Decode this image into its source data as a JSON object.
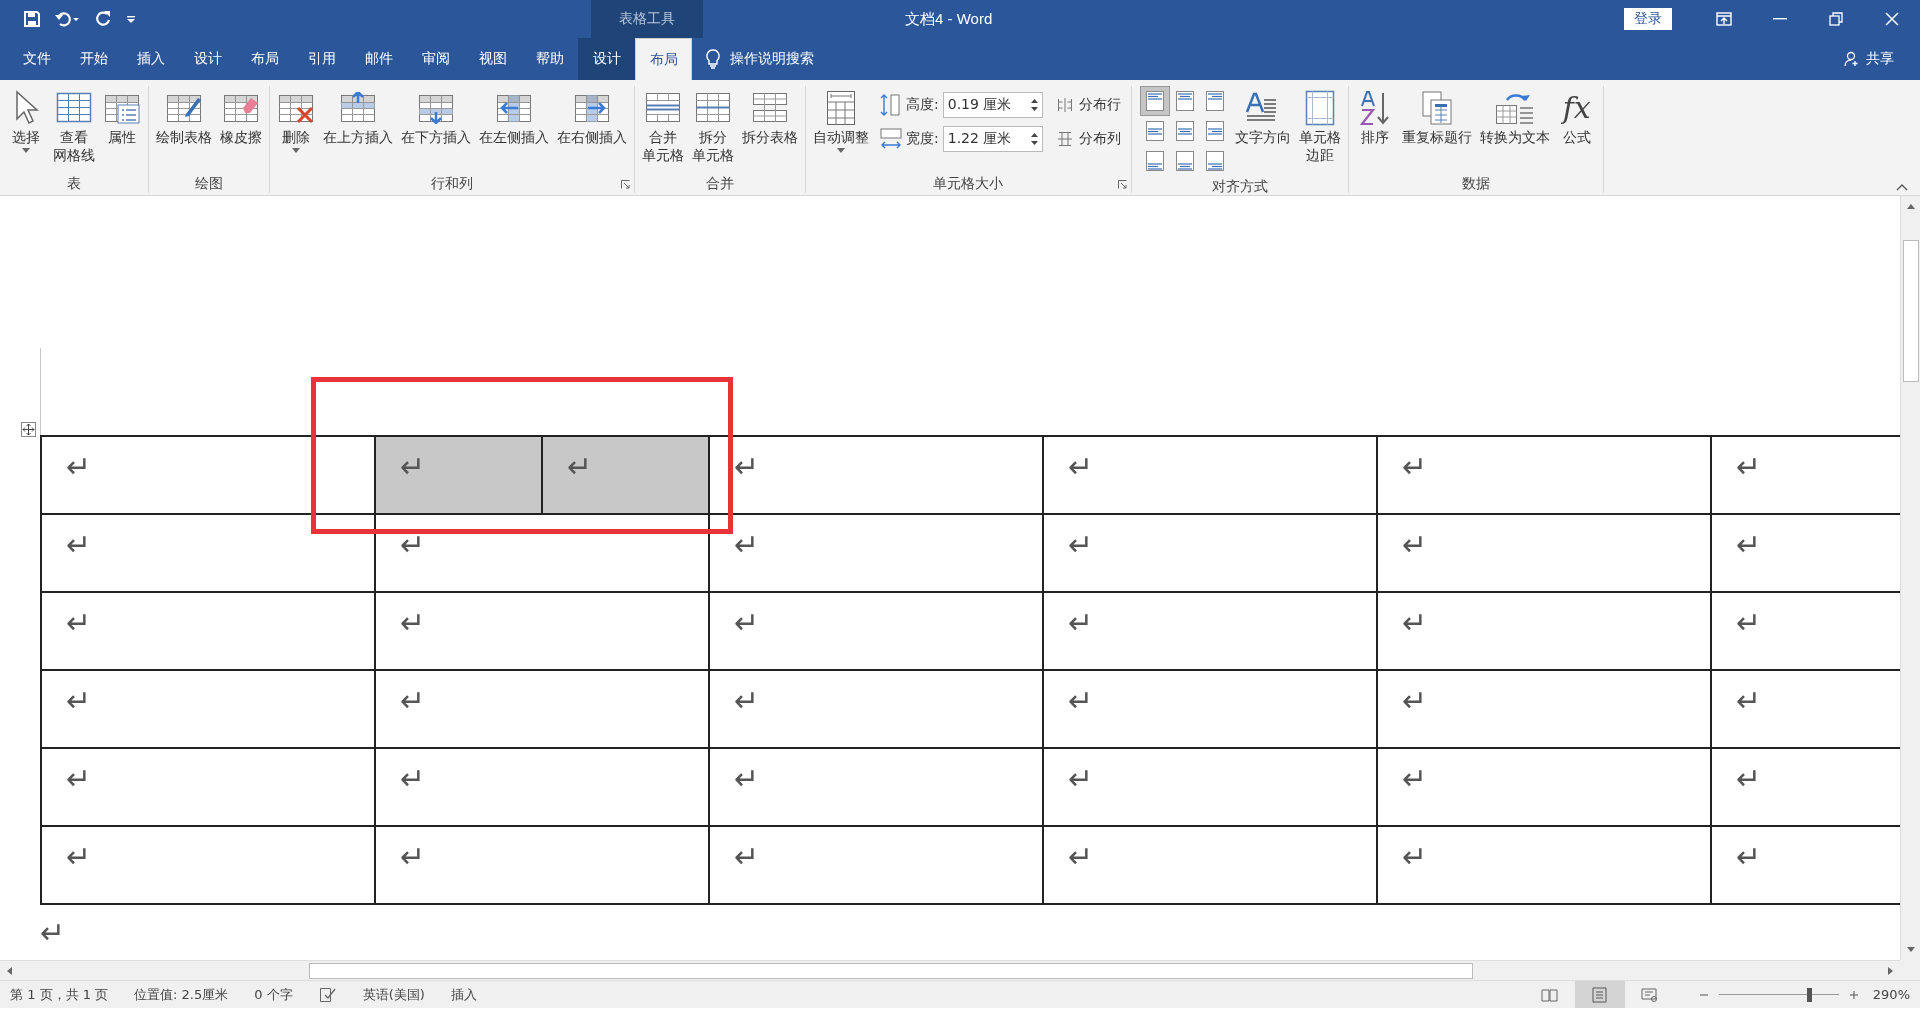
{
  "title_bar": {
    "context_group": "表格工具",
    "title": "文档4 - Word",
    "sign_in": "登录"
  },
  "menu_tabs": [
    {
      "label": "文件",
      "selected": false,
      "kind": "file"
    },
    {
      "label": "开始",
      "selected": false,
      "kind": "normal"
    },
    {
      "label": "插入",
      "selected": false,
      "kind": "normal"
    },
    {
      "label": "设计",
      "selected": false,
      "kind": "normal"
    },
    {
      "label": "布局",
      "selected": false,
      "kind": "normal"
    },
    {
      "label": "引用",
      "selected": false,
      "kind": "normal"
    },
    {
      "label": "邮件",
      "selected": false,
      "kind": "normal"
    },
    {
      "label": "审阅",
      "selected": false,
      "kind": "normal"
    },
    {
      "label": "视图",
      "selected": false,
      "kind": "normal"
    },
    {
      "label": "帮助",
      "selected": false,
      "kind": "normal"
    },
    {
      "label": "设计",
      "selected": false,
      "kind": "context"
    },
    {
      "label": "布局",
      "selected": true,
      "kind": "context"
    }
  ],
  "tell_me": {
    "placeholder": "操作说明搜索"
  },
  "share": "共享",
  "ribbon": [
    {
      "label": "表",
      "items": [
        {
          "kind": "large",
          "label": [
            "选择"
          ],
          "dropdown": true
        },
        {
          "kind": "large",
          "label": [
            "查看",
            "网格线"
          ]
        },
        {
          "kind": "large",
          "label": [
            "属性"
          ]
        }
      ]
    },
    {
      "label": "绘图",
      "items": [
        {
          "kind": "large",
          "label": [
            "绘制表格"
          ]
        },
        {
          "kind": "large",
          "label": [
            "橡皮擦"
          ]
        }
      ]
    },
    {
      "label": "行和列",
      "launcher": true,
      "items": [
        {
          "kind": "large",
          "label": [
            "删除"
          ],
          "dropdown": true
        },
        {
          "kind": "large",
          "label": [
            "在上方插入"
          ]
        },
        {
          "kind": "large",
          "label": [
            "在下方插入"
          ]
        },
        {
          "kind": "large",
          "label": [
            "在左侧插入"
          ]
        },
        {
          "kind": "large",
          "label": [
            "在右侧插入"
          ]
        }
      ]
    },
    {
      "label": "合并",
      "items": [
        {
          "kind": "large",
          "label": [
            "合并",
            "单元格"
          ]
        },
        {
          "kind": "large",
          "label": [
            "拆分",
            "单元格"
          ]
        },
        {
          "kind": "large",
          "label": [
            "拆分表格"
          ]
        }
      ]
    },
    {
      "label": "单元格大小",
      "launcher": true,
      "items": [
        {
          "kind": "large",
          "label": [
            "自动调整"
          ],
          "dropdown": true
        },
        {
          "kind": "fields",
          "fields": [
            {
              "label": "高度:",
              "value": "0.19 厘米"
            },
            {
              "label": "宽度:",
              "value": "1.22 厘米"
            }
          ]
        },
        {
          "kind": "small",
          "buttons": [
            "分布行",
            "分布列"
          ]
        }
      ]
    },
    {
      "label": "对齐方式",
      "items": [
        {
          "kind": "align",
          "cells": [
            {
              "selected": true
            },
            {
              "selected": false
            },
            {
              "selected": false
            },
            {
              "selected": false
            },
            {
              "selected": false
            },
            {
              "selected": false
            },
            {
              "selected": false
            },
            {
              "selected": false
            },
            {
              "selected": false
            }
          ]
        },
        {
          "kind": "large",
          "label": [
            "文字方向"
          ]
        },
        {
          "kind": "large",
          "label": [
            "单元格",
            "边距"
          ]
        }
      ]
    },
    {
      "label": "数据",
      "items": [
        {
          "kind": "large",
          "label": [
            "排序"
          ]
        },
        {
          "kind": "large",
          "label": [
            "重复标题行"
          ]
        },
        {
          "kind": "large",
          "label": [
            "转换为文本"
          ]
        },
        {
          "kind": "large",
          "label": [
            "公式"
          ],
          "icon_text": "fx"
        }
      ]
    }
  ],
  "table": {
    "rows": [
      [
        {
          "text": "↵",
          "selected": false
        },
        {
          "text": "↵",
          "selected": true
        },
        {
          "text": "↵",
          "selected": true
        },
        {
          "text": "↵",
          "selected": false
        },
        {
          "text": "↵",
          "selected": false
        },
        {
          "text": "↵",
          "selected": false
        },
        {
          "text": "↵",
          "selected": false
        }
      ],
      [
        {
          "text": "↵",
          "selected": false
        },
        {
          "text": "↵",
          "selected": false,
          "colspan": 2
        },
        {
          "text": "↵",
          "selected": false
        },
        {
          "text": "↵",
          "selected": false
        },
        {
          "text": "↵",
          "selected": false
        },
        {
          "text": "↵",
          "selected": false
        }
      ],
      [
        {
          "text": "↵",
          "selected": false
        },
        {
          "text": "↵",
          "selected": false,
          "colspan": 2
        },
        {
          "text": "↵",
          "selected": false
        },
        {
          "text": "↵",
          "selected": false
        },
        {
          "text": "↵",
          "selected": false
        },
        {
          "text": "↵",
          "selected": false
        }
      ],
      [
        {
          "text": "↵",
          "selected": false
        },
        {
          "text": "↵",
          "selected": false,
          "colspan": 2
        },
        {
          "text": "↵",
          "selected": false
        },
        {
          "text": "↵",
          "selected": false
        },
        {
          "text": "↵",
          "selected": false
        },
        {
          "text": "↵",
          "selected": false
        }
      ],
      [
        {
          "text": "↵",
          "selected": false
        },
        {
          "text": "↵",
          "selected": false,
          "colspan": 2
        },
        {
          "text": "↵",
          "selected": false
        },
        {
          "text": "↵",
          "selected": false
        },
        {
          "text": "↵",
          "selected": false
        },
        {
          "text": "↵",
          "selected": false
        }
      ],
      [
        {
          "text": "↵",
          "selected": false
        },
        {
          "text": "↵",
          "selected": false,
          "colspan": 2
        },
        {
          "text": "↵",
          "selected": false
        },
        {
          "text": "↵",
          "selected": false
        },
        {
          "text": "↵",
          "selected": false
        },
        {
          "text": "↵",
          "selected": false
        }
      ]
    ],
    "after_mark": "↵"
  },
  "annotation": {
    "kind": "rectangle"
  },
  "status_bar": {
    "items": [
      "第 1 页，共 1 页",
      "位置值: 2.5厘米",
      "0 个字",
      "英语(美国)",
      "插入"
    ],
    "views": [
      {
        "selected": false
      },
      {
        "selected": true
      },
      {
        "selected": false
      }
    ],
    "zoom": {
      "level": 0.75,
      "reading": "290%"
    }
  }
}
